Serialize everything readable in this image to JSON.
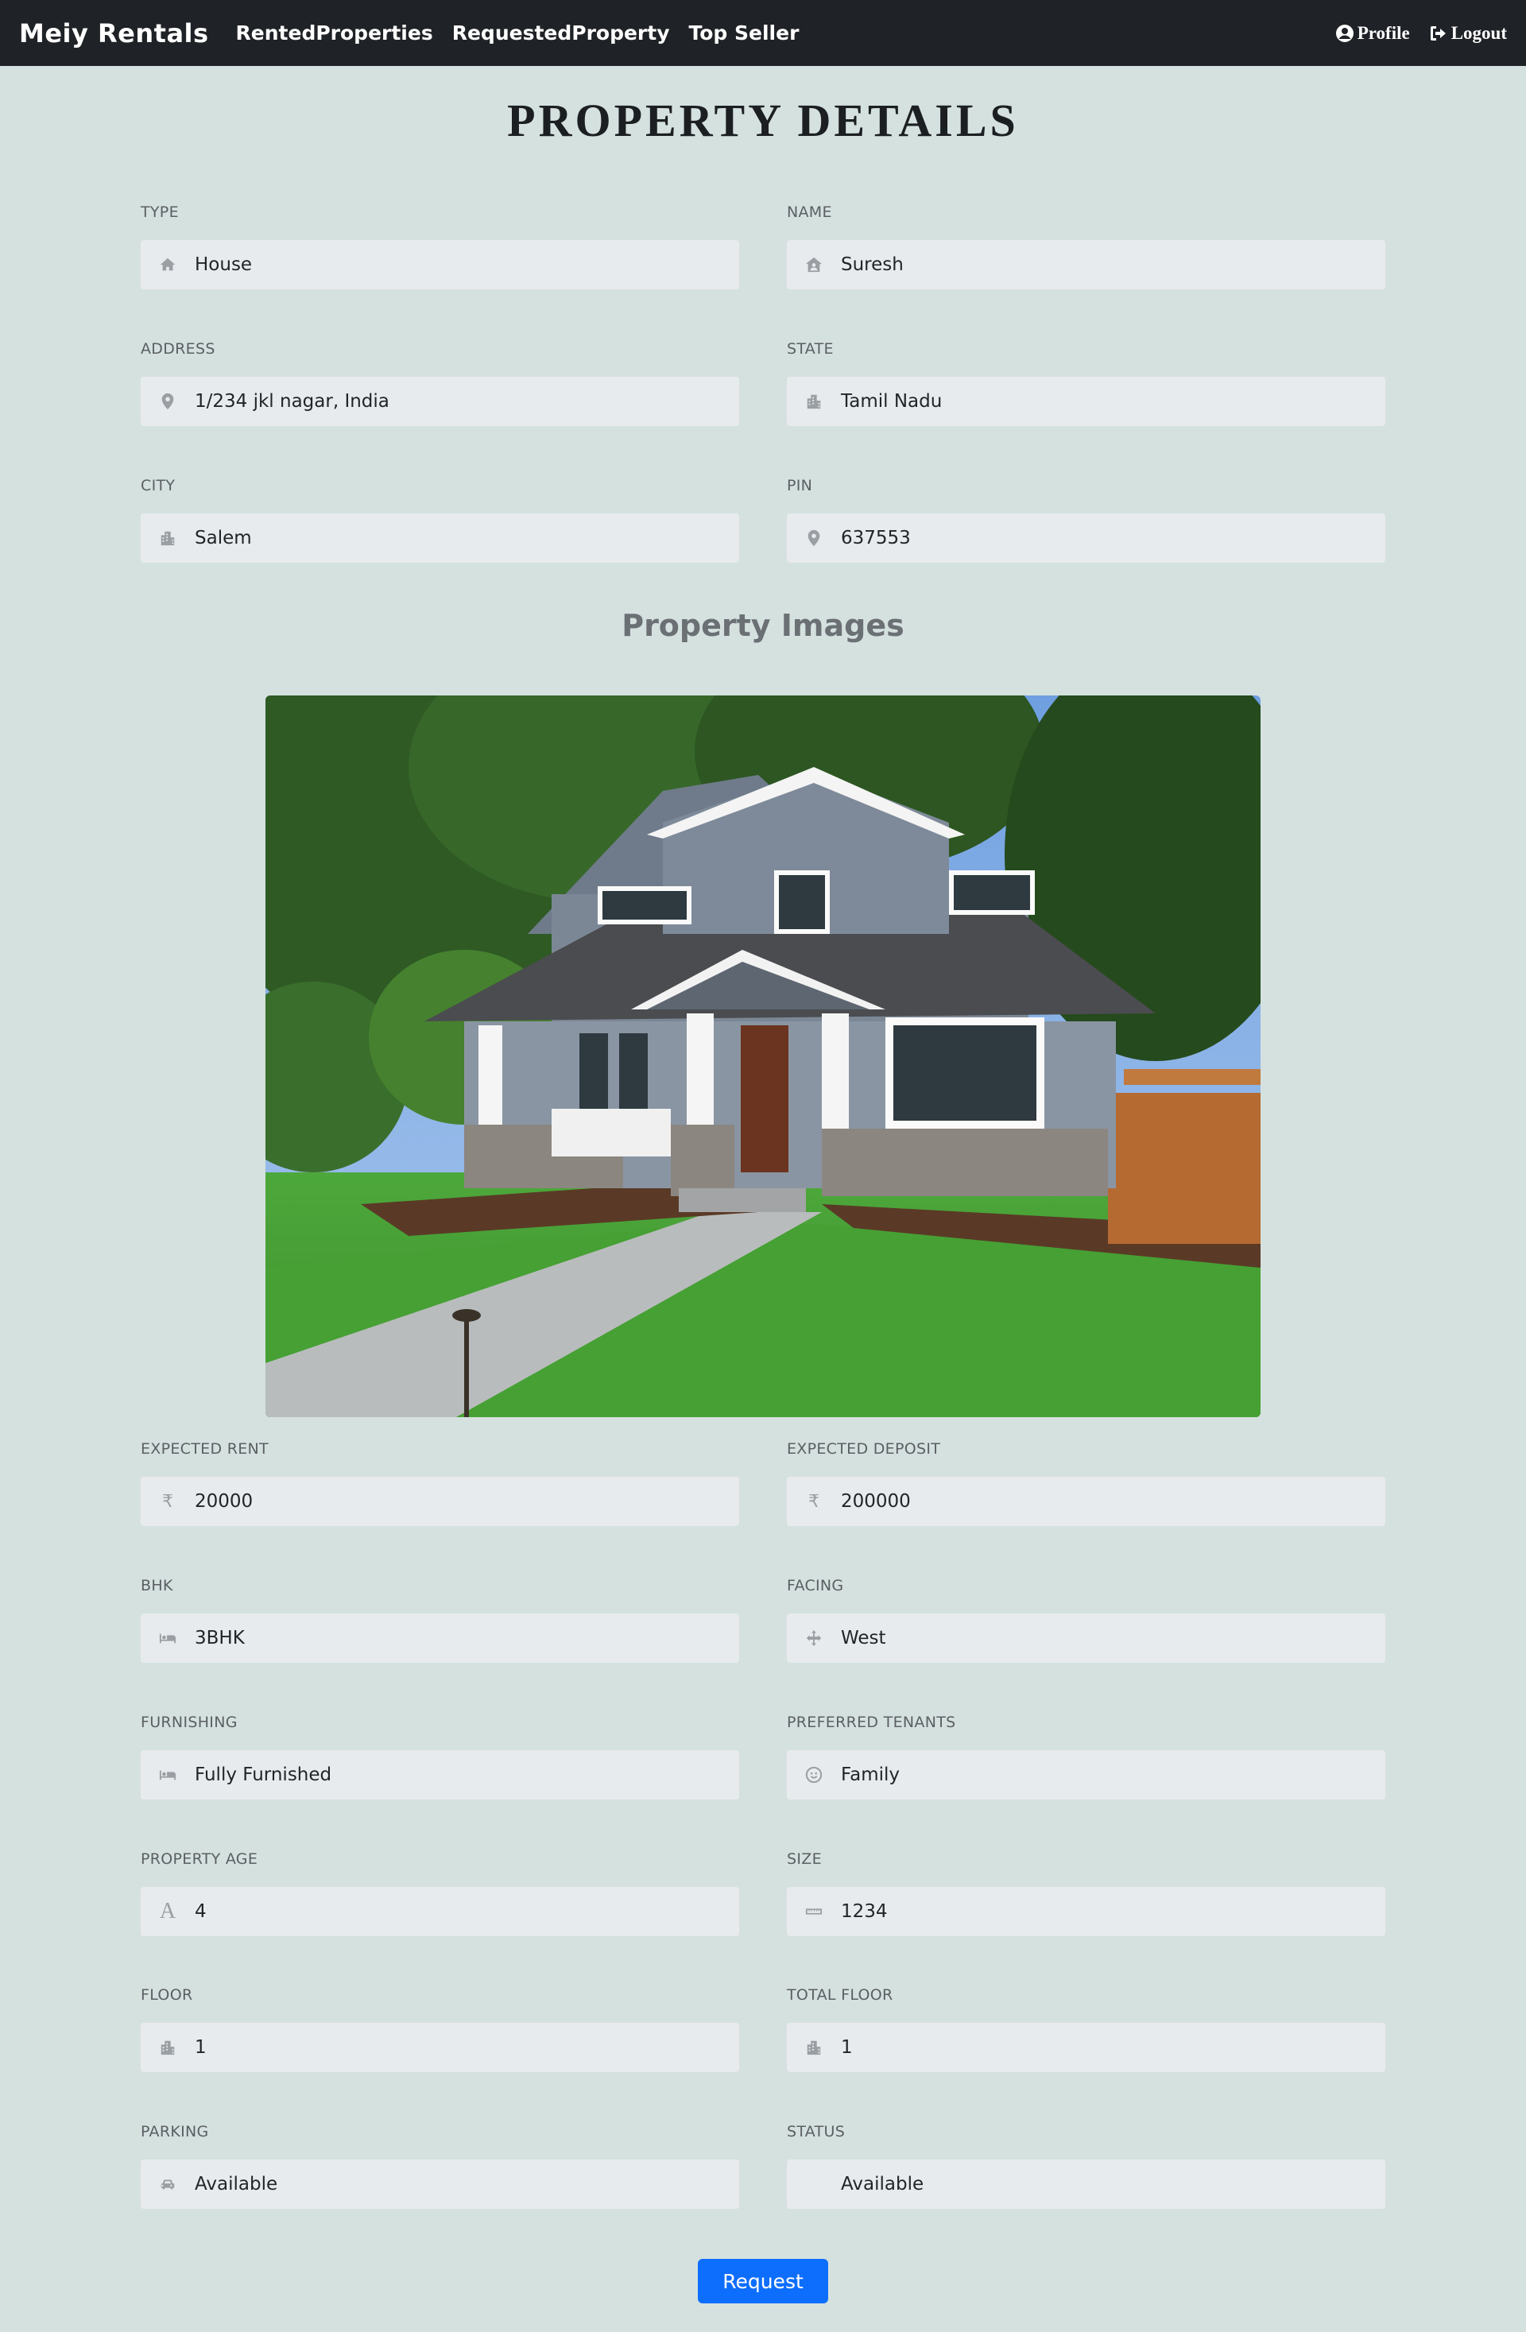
{
  "navbar": {
    "brand": "Meiy Rentals",
    "links": [
      "RentedProperties",
      "RequestedProperty",
      "Top Seller"
    ],
    "profile": "Profile",
    "logout": "Logout"
  },
  "page_title": "PROPERTY DETAILS",
  "fields_top": [
    {
      "label": "TYPE",
      "value": "House",
      "icon": "home-icon"
    },
    {
      "label": "NAME",
      "value": "Suresh",
      "icon": "house-user-icon"
    },
    {
      "label": "ADDRESS",
      "value": "1/234 jkl nagar, India",
      "icon": "map-pin-icon"
    },
    {
      "label": "STATE",
      "value": "Tamil Nadu",
      "icon": "city-icon"
    },
    {
      "label": "CITY",
      "value": "Salem",
      "icon": "city-icon"
    },
    {
      "label": "PIN",
      "value": "637553",
      "icon": "map-pin-icon"
    }
  ],
  "images_title": "Property Images",
  "fields_bottom": [
    {
      "label": "EXPECTED RENT",
      "value": "20000",
      "icon": "rupee-icon"
    },
    {
      "label": "EXPECTED DEPOSIT",
      "value": "200000",
      "icon": "rupee-icon"
    },
    {
      "label": "BHK",
      "value": "3BHK",
      "icon": "bed-icon"
    },
    {
      "label": "FACING",
      "value": "West",
      "icon": "compass-arrows-icon"
    },
    {
      "label": "FURNISHING",
      "value": "Fully Furnished",
      "icon": "bed-icon"
    },
    {
      "label": "PREFERRED TENANTS",
      "value": "Family",
      "icon": "smile-icon"
    },
    {
      "label": "PROPERTY AGE",
      "value": "4",
      "icon": "letter-a-icon"
    },
    {
      "label": "SIZE",
      "value": "1234",
      "icon": "ruler-icon"
    },
    {
      "label": "FLOOR",
      "value": "1",
      "icon": "city-icon"
    },
    {
      "label": "TOTAL FLOOR",
      "value": "1",
      "icon": "city-icon"
    },
    {
      "label": "PARKING",
      "value": "Available",
      "icon": "car-icon"
    },
    {
      "label": "STATUS",
      "value": "Available",
      "icon": ""
    }
  ],
  "request_button": "Request"
}
